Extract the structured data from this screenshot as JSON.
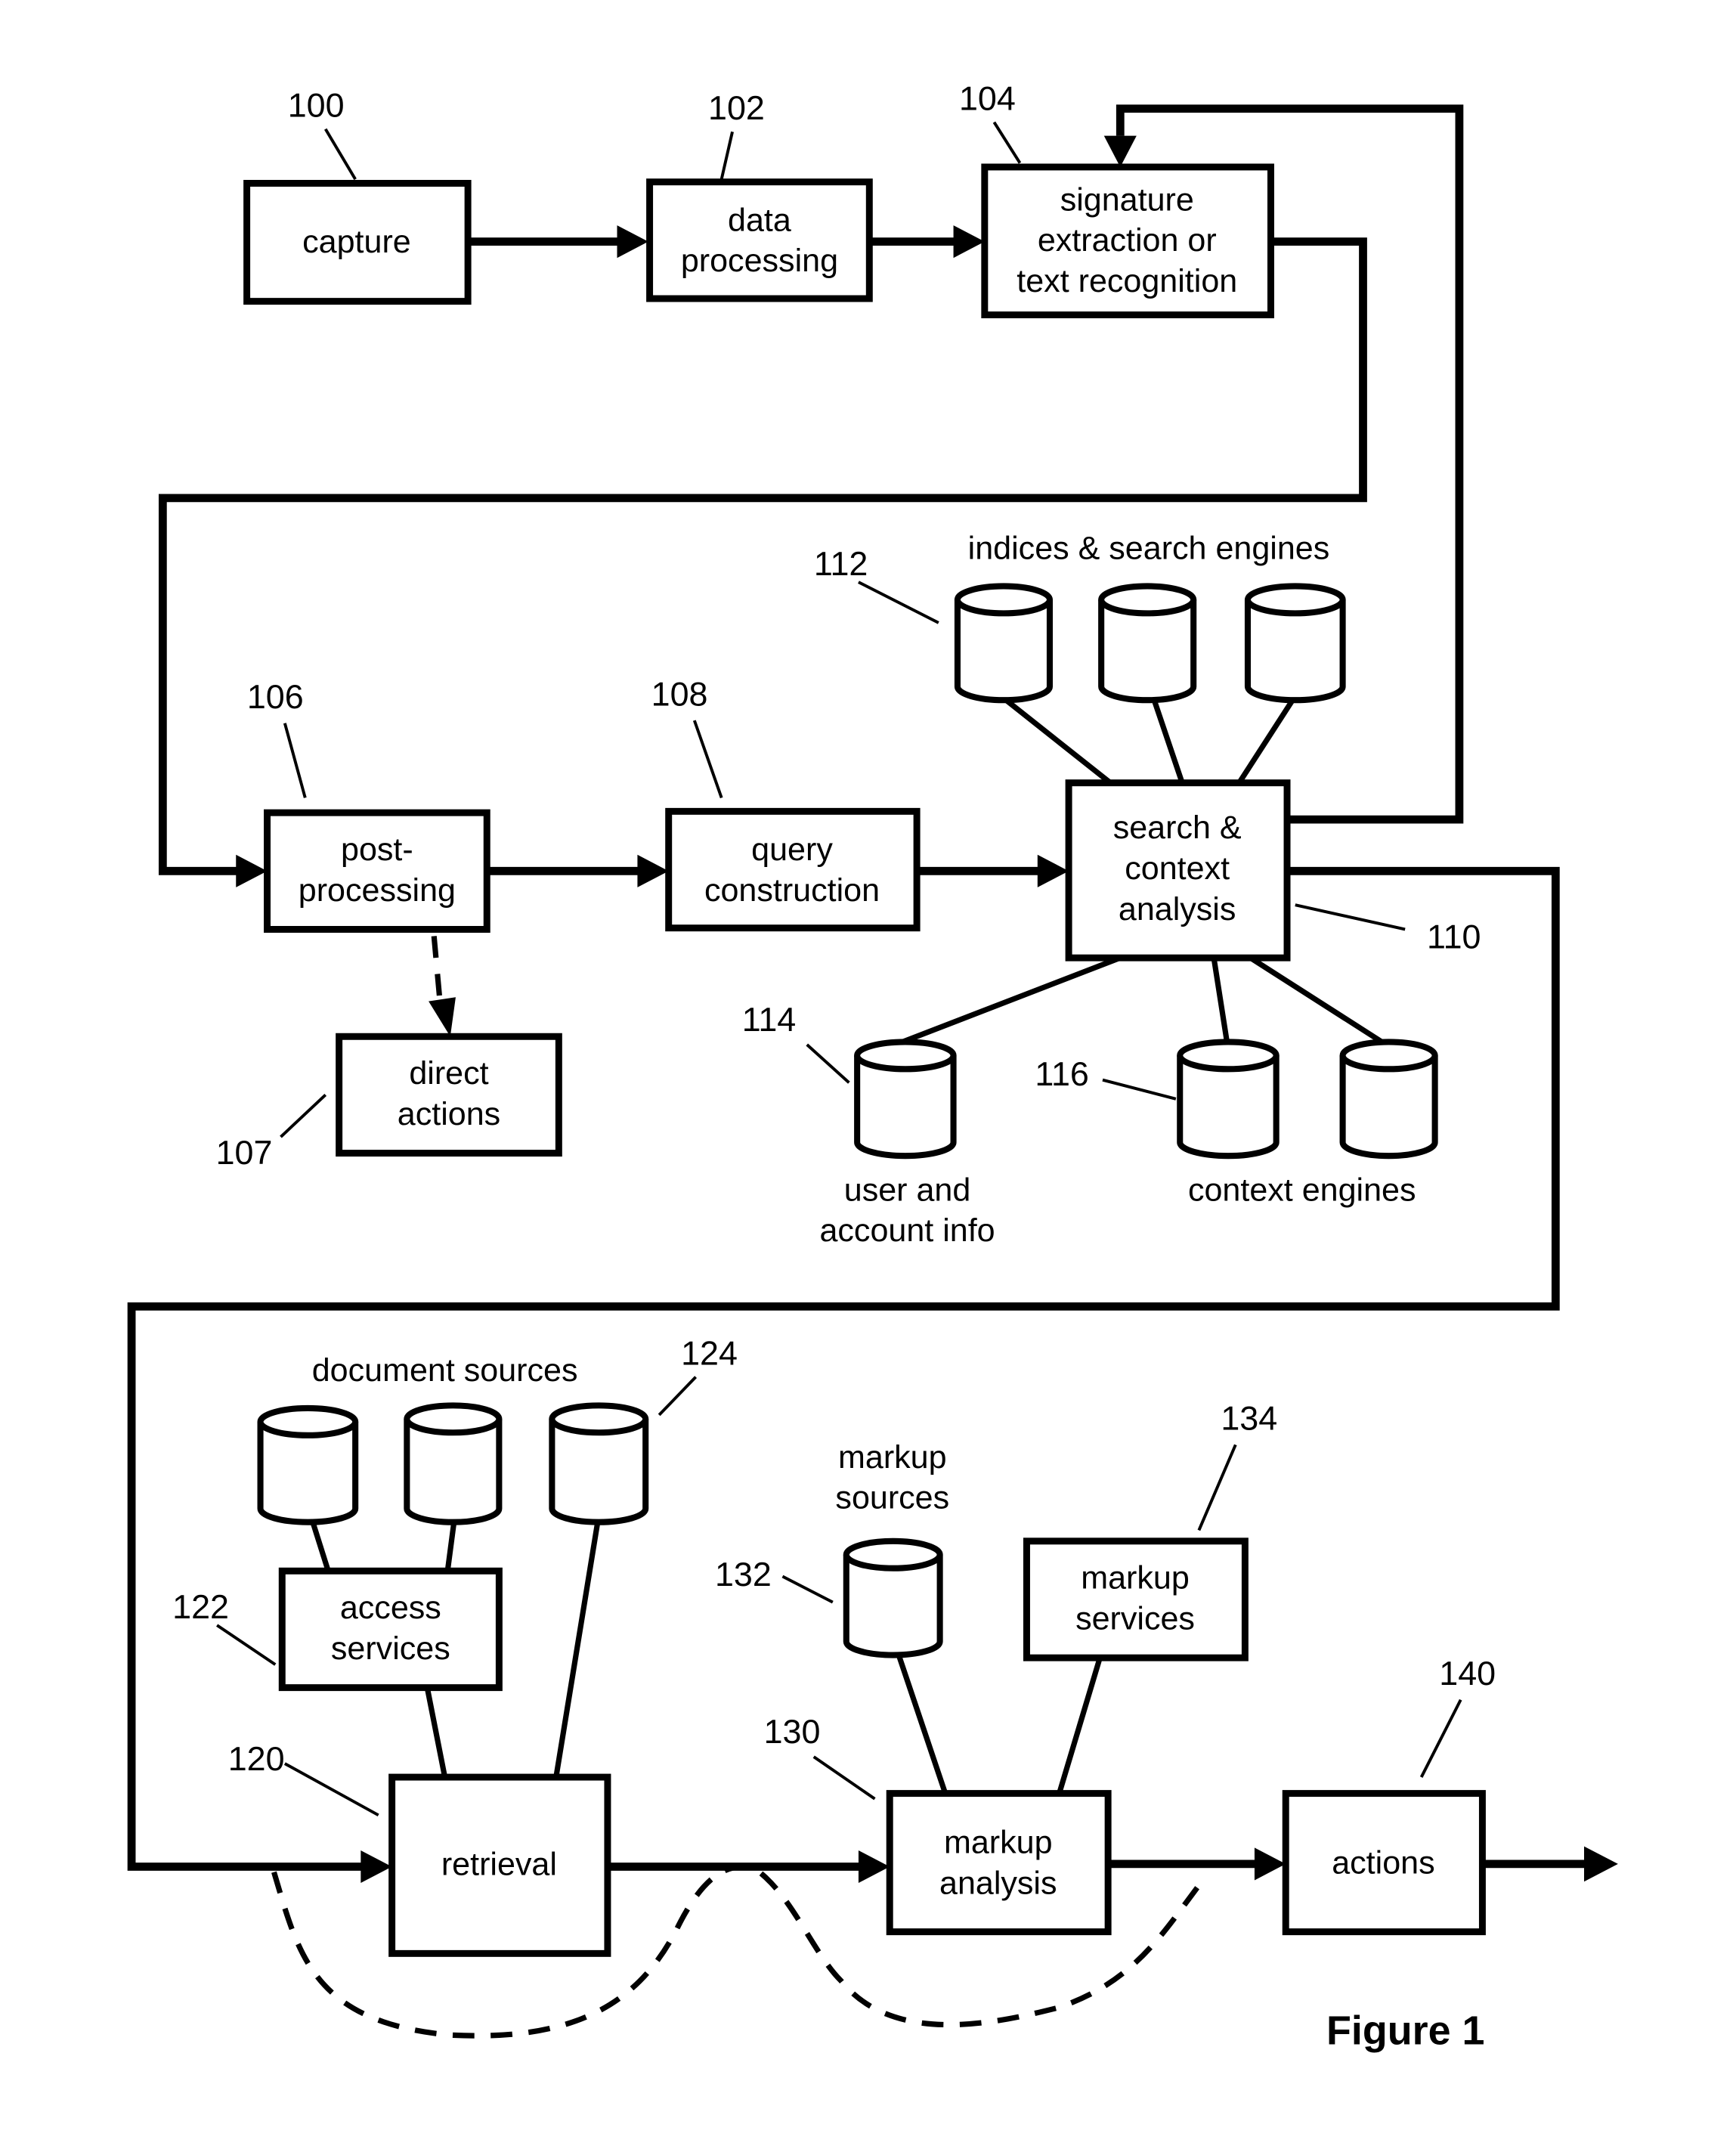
{
  "figure_title": "Figure 1",
  "boxes": {
    "capture": {
      "ref": "100",
      "lines": [
        "capture"
      ]
    },
    "data_processing": {
      "ref": "102",
      "lines": [
        "data",
        "processing"
      ]
    },
    "signature": {
      "ref": "104",
      "lines": [
        "signature",
        "extraction or",
        "text recognition"
      ]
    },
    "post_processing": {
      "ref": "106",
      "lines": [
        "post-",
        "processing"
      ]
    },
    "direct_actions": {
      "ref": "107",
      "lines": [
        "direct",
        "actions"
      ]
    },
    "query_construction": {
      "ref": "108",
      "lines": [
        "query",
        "construction"
      ]
    },
    "search_context": {
      "ref": "110",
      "lines": [
        "search &",
        "context",
        "analysis"
      ]
    },
    "retrieval": {
      "ref": "120",
      "lines": [
        "retrieval"
      ]
    },
    "access_services": {
      "ref": "122",
      "lines": [
        "access",
        "services"
      ]
    },
    "markup_analysis": {
      "ref": "130",
      "lines": [
        "markup",
        "analysis"
      ]
    },
    "markup_services": {
      "ref": "134",
      "lines": [
        "markup",
        "services"
      ]
    },
    "actions": {
      "ref": "140",
      "lines": [
        "actions"
      ]
    }
  },
  "stores": {
    "indices": {
      "ref": "112",
      "caption": [
        "indices & search engines"
      ]
    },
    "user_account": {
      "ref": "114",
      "caption": [
        "user and",
        "account info"
      ]
    },
    "context_engines": {
      "ref": "116",
      "caption": [
        "context engines"
      ]
    },
    "document_sources": {
      "ref": "124",
      "caption": [
        "document sources"
      ]
    },
    "markup_sources": {
      "ref": "132",
      "caption": [
        "markup",
        "sources"
      ]
    }
  }
}
